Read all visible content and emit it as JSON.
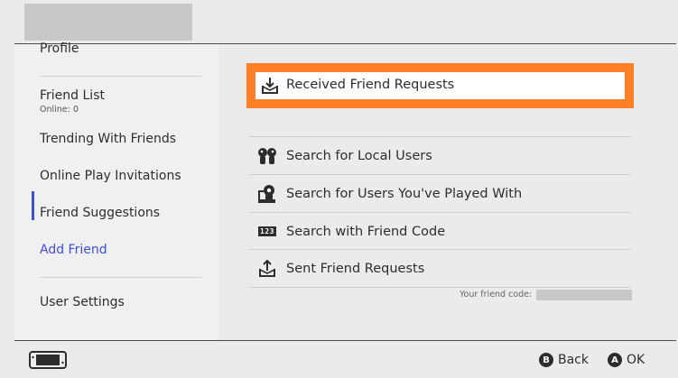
{
  "sidebar": {
    "items": [
      {
        "label": "Profile"
      },
      {
        "label": "Friend List",
        "sub": "Online: 0"
      },
      {
        "label": "Trending With Friends"
      },
      {
        "label": "Online Play Invitations"
      },
      {
        "label": "Friend Suggestions"
      },
      {
        "label": "Add Friend",
        "active": true
      },
      {
        "label": "User Settings"
      }
    ]
  },
  "main": {
    "selected": {
      "label": "Received Friend Requests",
      "icon": "inbox-download-icon"
    },
    "rows": [
      {
        "label": "Search for Local Users",
        "icon": "local-users-icon"
      },
      {
        "label": "Search for Users You've Played With",
        "icon": "played-with-icon"
      },
      {
        "label": "Search with Friend Code",
        "icon": "friend-code-icon",
        "glyph": "123"
      },
      {
        "label": "Sent Friend Requests",
        "icon": "outbox-upload-icon"
      }
    ],
    "friend_code_label": "Your friend code:"
  },
  "footer": {
    "back": {
      "button": "B",
      "label": "Back"
    },
    "ok": {
      "button": "A",
      "label": "OK"
    }
  },
  "colors": {
    "accent": "#3f4fd8",
    "selection": "#ff7f26",
    "background": "#ebebeb"
  }
}
